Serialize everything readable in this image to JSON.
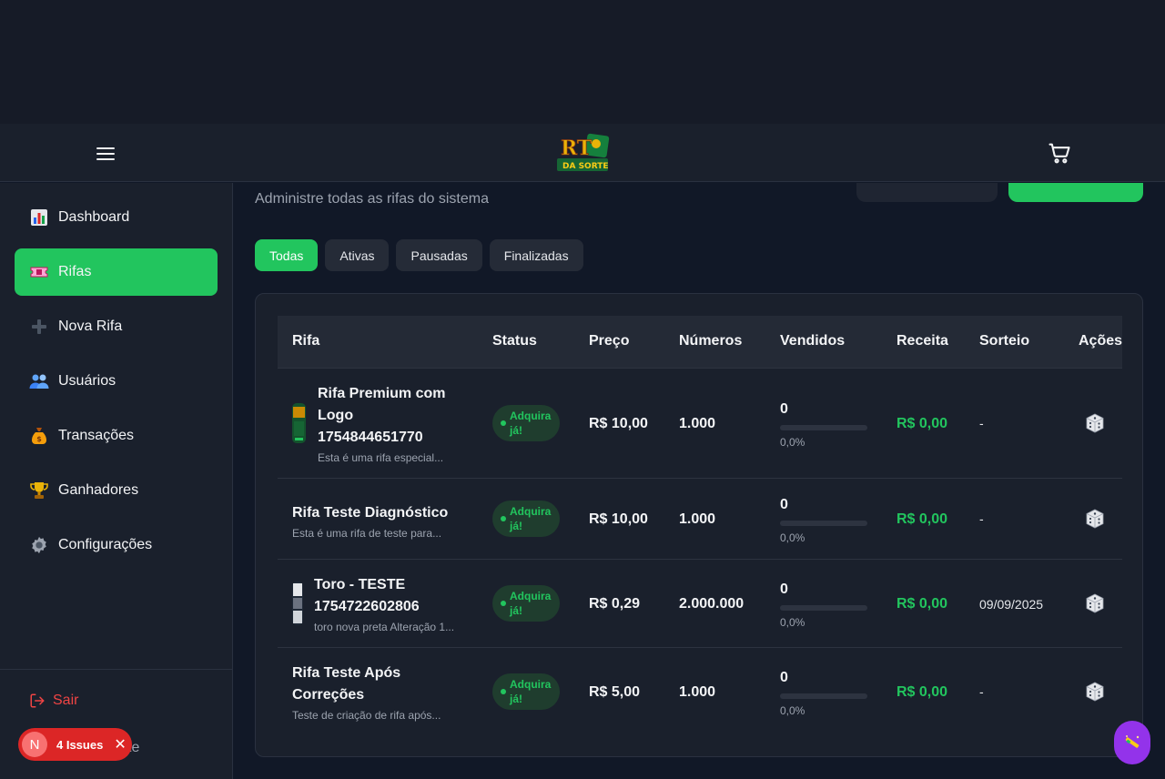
{
  "header": {
    "logo_text_top": "RT",
    "logo_text_bottom": "DA SORTE"
  },
  "sidebar": {
    "items": [
      {
        "label": "Dashboard",
        "icon": "bar-chart-icon"
      },
      {
        "label": "Rifas",
        "icon": "ticket-icon",
        "active": true
      },
      {
        "label": "Nova Rifa",
        "icon": "plus-icon"
      },
      {
        "label": "Usuários",
        "icon": "users-icon"
      },
      {
        "label": "Transações",
        "icon": "money-bag-icon"
      },
      {
        "label": "Ganhadores",
        "icon": "trophy-icon"
      },
      {
        "label": "Configurações",
        "icon": "gear-icon"
      }
    ],
    "logout_label": "Sair",
    "partial_item_label": "te"
  },
  "main": {
    "subtitle": "Administre todas as rifas do sistema",
    "filters": [
      "Todas",
      "Ativas",
      "Pausadas",
      "Finalizadas"
    ],
    "table": {
      "headers": [
        "Rifa",
        "Status",
        "Preço",
        "Números",
        "Vendidos",
        "Receita",
        "Sorteio",
        "Ações"
      ],
      "rows": [
        {
          "title_lines": [
            "Rifa Premium com",
            "Logo",
            "1754844651770"
          ],
          "desc": "Esta é uma rifa especial...",
          "has_thumb": true,
          "status_lines": [
            "Adquira",
            "já!"
          ],
          "price": "R$ 10,00",
          "numbers": "1.000",
          "sold": "0",
          "sold_pct": "0,0%",
          "sold_fraction": 0,
          "revenue": "R$ 0,00",
          "draw": "-"
        },
        {
          "title_lines": [
            "Rifa Teste Diagnóstico"
          ],
          "desc": "Esta é uma rifa de teste para...",
          "has_thumb": false,
          "status_lines": [
            "Adquira",
            "já!"
          ],
          "price": "R$ 10,00",
          "numbers": "1.000",
          "sold": "0",
          "sold_pct": "0,0%",
          "sold_fraction": 0,
          "revenue": "R$ 0,00",
          "draw": "-"
        },
        {
          "title_lines": [
            "Toro - TESTE",
            "1754722602806"
          ],
          "desc": "toro nova preta Alteração 1...",
          "has_thumb": true,
          "status_lines": [
            "Adquira",
            "já!"
          ],
          "price": "R$ 0,29",
          "numbers": "2.000.000",
          "sold": "0",
          "sold_pct": "0,0%",
          "sold_fraction": 0,
          "revenue": "R$ 0,00",
          "draw": "09/09/2025"
        },
        {
          "title_lines": [
            "Rifa Teste Após",
            "Correções"
          ],
          "desc": "Teste de criação de rifa após...",
          "has_thumb": false,
          "status_lines": [
            "Adquira",
            "já!"
          ],
          "price": "R$ 5,00",
          "numbers": "1.000",
          "sold": "0",
          "sold_pct": "0,0%",
          "sold_fraction": 0,
          "revenue": "R$ 0,00",
          "draw": "-"
        }
      ]
    }
  },
  "dev_overlay": {
    "badge_letter": "N",
    "issues_label": "4 Issues"
  },
  "colors": {
    "accent": "#22c55e",
    "background": "#111827",
    "panel": "#1a202c",
    "danger": "#ef4444",
    "float_button": "#9333ea"
  }
}
